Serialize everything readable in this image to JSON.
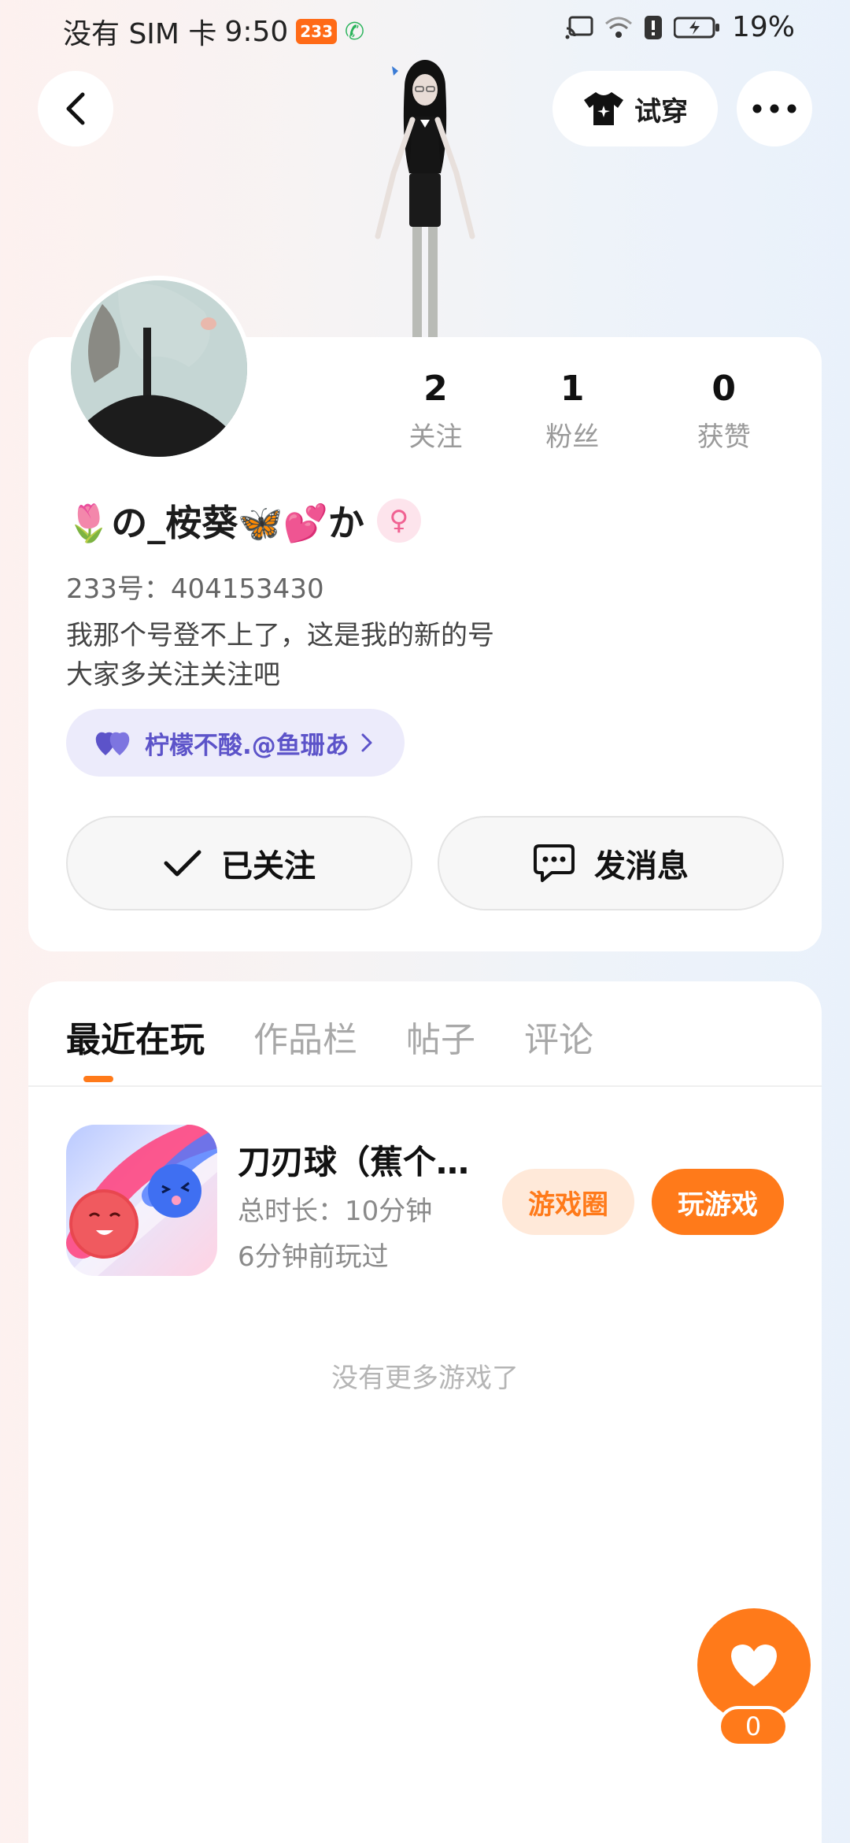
{
  "status_bar": {
    "carrier": "没有 SIM 卡",
    "time": "9:50",
    "app_badge": "233",
    "battery": "19%"
  },
  "header": {
    "tryon_label": "试穿"
  },
  "profile": {
    "stats": [
      {
        "value": "2",
        "label": "关注"
      },
      {
        "value": "1",
        "label": "粉丝"
      },
      {
        "value": "0",
        "label": "获赞"
      }
    ],
    "nickname": "🌷の_桉葵🦋💕か",
    "gender_symbol": "♀",
    "user_id": "233号：404153430",
    "bio": "我那个号登不上了，这是我的新的号\n大家多关注关注吧",
    "cp_tag": "柠檬不酸.@鱼珊あ",
    "follow_label": "已关注",
    "message_label": "发消息"
  },
  "tabs": [
    {
      "label": "最近在玩"
    },
    {
      "label": "作品栏"
    },
    {
      "label": "帖子"
    },
    {
      "label": "评论"
    }
  ],
  "games": [
    {
      "title": "刀刃球（蕉个…",
      "duration": "总时长：10分钟",
      "last_played": "6分钟前玩过",
      "circle_label": "游戏圈",
      "play_label": "玩游戏"
    }
  ],
  "no_more_text": "没有更多游戏了",
  "like_count": "0",
  "colors": {
    "accent": "#ff7a1a",
    "cp_purple": "#5c53c9"
  }
}
